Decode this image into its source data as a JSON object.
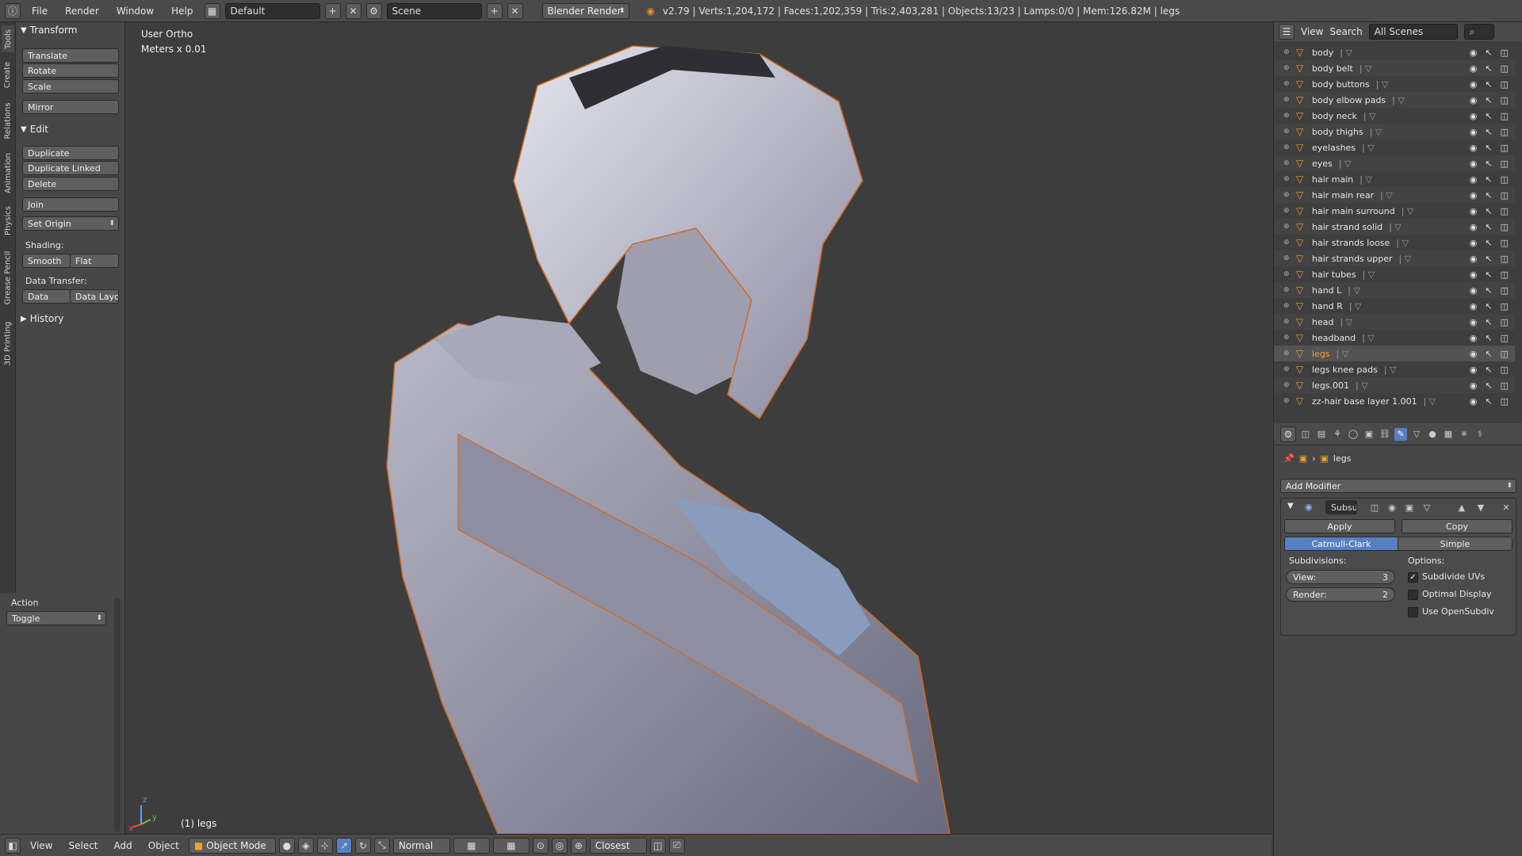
{
  "topbar": {
    "menus": [
      "File",
      "Render",
      "Window",
      "Help"
    ],
    "layout": "Default",
    "scene": "Scene",
    "engine": "Blender Render",
    "stats": "v2.79 | Verts:1,204,172 | Faces:1,202,359 | Tris:2,403,281 | Objects:13/23 | Lamps:0/0 | Mem:126.82M | legs"
  },
  "tooltabs": [
    "Tools",
    "Create",
    "Relations",
    "Animation",
    "Physics",
    "Grease Pencil",
    "3D Printing"
  ],
  "toolshelf": {
    "transform": {
      "title": "Transform",
      "translate": "Translate",
      "rotate": "Rotate",
      "scale": "Scale",
      "mirror": "Mirror"
    },
    "edit": {
      "title": "Edit",
      "duplicate": "Duplicate",
      "duplicate_linked": "Duplicate Linked",
      "delete": "Delete",
      "join": "Join",
      "set_origin": "Set Origin",
      "shading_label": "Shading:",
      "smooth": "Smooth",
      "flat": "Flat",
      "data_transfer_label": "Data Transfer:",
      "data": "Data",
      "data_layout": "Data Layo"
    },
    "history": {
      "title": "History"
    }
  },
  "operator": {
    "title": "Action",
    "value": "Toggle"
  },
  "viewport": {
    "view_name": "User Ortho",
    "units": "Meters x 0.01",
    "object_label": "(1) legs",
    "axis_x": "x",
    "axis_y": "y",
    "axis_z": "z"
  },
  "bottombar": {
    "menus": [
      "View",
      "Select",
      "Add",
      "Object"
    ],
    "mode": "Object Mode",
    "orientation": "Normal",
    "snap": "Closest"
  },
  "outliner": {
    "menus": [
      "View",
      "Search"
    ],
    "scope": "All Scenes",
    "items": [
      {
        "name": "body"
      },
      {
        "name": "body belt"
      },
      {
        "name": "body buttons"
      },
      {
        "name": "body elbow pads"
      },
      {
        "name": "body neck"
      },
      {
        "name": "body thighs"
      },
      {
        "name": "eyelashes"
      },
      {
        "name": "eyes"
      },
      {
        "name": "hair main"
      },
      {
        "name": "hair main rear"
      },
      {
        "name": "hair main surround"
      },
      {
        "name": "hair strand solid"
      },
      {
        "name": "hair strands loose"
      },
      {
        "name": "hair strands upper"
      },
      {
        "name": "hair tubes"
      },
      {
        "name": "hand L"
      },
      {
        "name": "hand R"
      },
      {
        "name": "head"
      },
      {
        "name": "headband"
      },
      {
        "name": "legs"
      },
      {
        "name": "legs knee pads"
      },
      {
        "name": "legs.001"
      },
      {
        "name": "zz-hair base layer 1.001"
      }
    ]
  },
  "properties": {
    "object_name": "legs",
    "add_modifier": "Add Modifier",
    "modifier_name": "Subsu",
    "apply": "Apply",
    "copy": "Copy",
    "catmull": "Catmull-Clark",
    "simple": "Simple",
    "subdivisions_label": "Subdivisions:",
    "options_label": "Options:",
    "view_label": "View:",
    "view_value": "3",
    "render_label": "Render:",
    "render_value": "2",
    "subdivide_uvs": "Subdivide UVs",
    "optimal_display": "Optimal Display",
    "use_opensubdiv": "Use OpenSubdiv"
  },
  "colors": {
    "accent_blue": "#5680c2",
    "selection_orange": "#f0a030",
    "viewport_bg": "#3d3d3d"
  }
}
